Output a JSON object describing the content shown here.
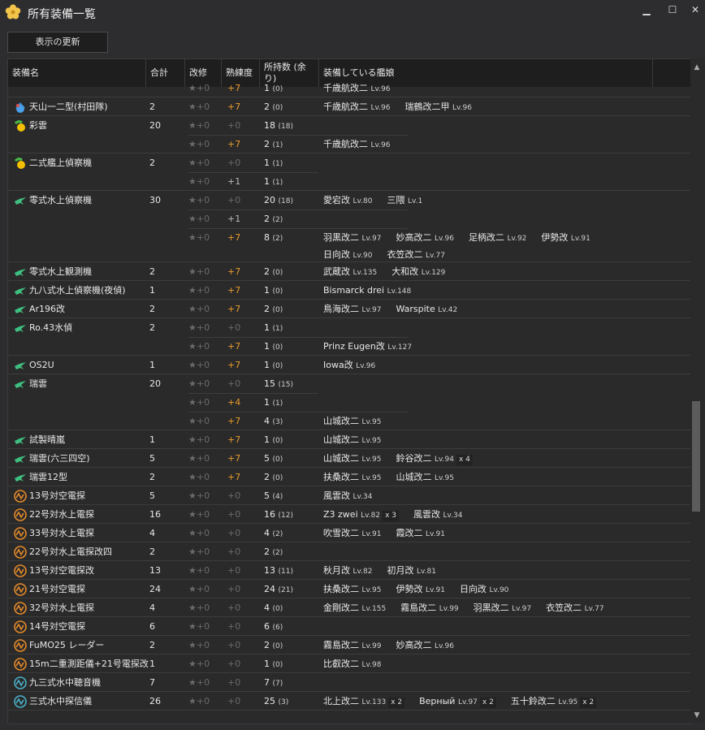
{
  "window": {
    "title": "所有装備一覧",
    "min": "▁",
    "max": "☐",
    "close": "✕"
  },
  "toolbar": {
    "refresh_label": "表示の更新"
  },
  "columns": [
    "装備名",
    "合計",
    "改修",
    "熟練度",
    "所持数 (余り)",
    "装備している艦娘"
  ],
  "rows": [
    {
      "name": "",
      "icon": "",
      "total": "",
      "subs": [
        {
          "imp": "★+0",
          "prof": "+7",
          "ptype": "pp",
          "count": "1",
          "rem": "(0)",
          "ships": [
            {
              "n": "千歳航改二",
              "lv": "Lv.96"
            }
          ]
        }
      ]
    },
    {
      "name": "天山一二型(村田隊)",
      "icon": "torpedo-bomber-icon",
      "total": "2",
      "subs": [
        {
          "imp": "★+0",
          "prof": "+7",
          "ptype": "pp",
          "count": "2",
          "rem": "(0)",
          "ships": [
            {
              "n": "千歳航改二",
              "lv": "Lv.96"
            },
            {
              "n": "瑞鶴改二甲",
              "lv": "Lv.96"
            }
          ]
        }
      ]
    },
    {
      "name": "彩雲",
      "icon": "recon-plane-icon",
      "total": "20",
      "subs": [
        {
          "imp": "★+0",
          "prof": "+0",
          "ptype": "p0",
          "count": "18",
          "rem": "(18)",
          "ships": []
        },
        {
          "imp": "★+0",
          "prof": "+7",
          "ptype": "pp",
          "count": "2",
          "rem": "(1)",
          "ships": [
            {
              "n": "千歳航改二",
              "lv": "Lv.96"
            }
          ]
        }
      ]
    },
    {
      "name": "二式艦上偵察機",
      "icon": "recon-plane-icon",
      "total": "2",
      "subs": [
        {
          "imp": "★+0",
          "prof": "+0",
          "ptype": "p0",
          "count": "1",
          "rem": "(1)",
          "ships": []
        },
        {
          "imp": "★+0",
          "prof": "+1",
          "ptype": "p1",
          "count": "1",
          "rem": "(1)",
          "ships": []
        }
      ]
    },
    {
      "name": "零式水上偵察機",
      "icon": "seaplane-icon",
      "total": "30",
      "subs": [
        {
          "imp": "★+0",
          "prof": "+0",
          "ptype": "p0",
          "count": "20",
          "rem": "(18)",
          "ships": [
            {
              "n": "愛宕改",
              "lv": "Lv.80"
            },
            {
              "n": "三隈",
              "lv": "Lv.1"
            }
          ]
        },
        {
          "imp": "★+0",
          "prof": "+1",
          "ptype": "p1",
          "count": "2",
          "rem": "(2)",
          "ships": []
        },
        {
          "imp": "★+0",
          "prof": "+7",
          "ptype": "pp",
          "count": "8",
          "rem": "(2)",
          "tall": true,
          "ships": [
            {
              "n": "羽黒改二",
              "lv": "Lv.97"
            },
            {
              "n": "妙高改二",
              "lv": "Lv.96"
            },
            {
              "n": "足柄改二",
              "lv": "Lv.92"
            },
            {
              "n": "伊勢改",
              "lv": "Lv.91"
            },
            {
              "n": "日向改",
              "lv": "Lv.90"
            },
            {
              "n": "衣笠改二",
              "lv": "Lv.77"
            }
          ]
        }
      ]
    },
    {
      "name": "零式水上観測機",
      "icon": "seaplane-icon",
      "total": "2",
      "subs": [
        {
          "imp": "★+0",
          "prof": "+7",
          "ptype": "pp",
          "count": "2",
          "rem": "(0)",
          "ships": [
            {
              "n": "武蔵改",
              "lv": "Lv.135"
            },
            {
              "n": "大和改",
              "lv": "Lv.129"
            }
          ]
        }
      ]
    },
    {
      "name": "九八式水上偵察機(夜偵)",
      "icon": "seaplane-icon",
      "total": "1",
      "subs": [
        {
          "imp": "★+0",
          "prof": "+7",
          "ptype": "pp",
          "count": "1",
          "rem": "(0)",
          "ships": [
            {
              "n": "Bismarck drei",
              "lv": "Lv.148"
            }
          ]
        }
      ]
    },
    {
      "name": "Ar196改",
      "icon": "seaplane-icon",
      "total": "2",
      "subs": [
        {
          "imp": "★+0",
          "prof": "+7",
          "ptype": "pp",
          "count": "2",
          "rem": "(0)",
          "ships": [
            {
              "n": "鳥海改二",
              "lv": "Lv.97"
            },
            {
              "n": "Warspite",
              "lv": "Lv.42"
            }
          ]
        }
      ]
    },
    {
      "name": "Ro.43水偵",
      "icon": "seaplane-icon",
      "total": "2",
      "subs": [
        {
          "imp": "★+0",
          "prof": "+0",
          "ptype": "p0",
          "count": "1",
          "rem": "(1)",
          "ships": []
        },
        {
          "imp": "★+0",
          "prof": "+7",
          "ptype": "pp",
          "count": "1",
          "rem": "(0)",
          "ships": [
            {
              "n": "Prinz Eugen改",
              "lv": "Lv.127"
            }
          ]
        }
      ]
    },
    {
      "name": "OS2U",
      "icon": "seaplane-icon",
      "total": "1",
      "subs": [
        {
          "imp": "★+0",
          "prof": "+7",
          "ptype": "pp",
          "count": "1",
          "rem": "(0)",
          "ships": [
            {
              "n": "Iowa改",
              "lv": "Lv.96"
            }
          ]
        }
      ]
    },
    {
      "name": "瑞雲",
      "icon": "seaplane-icon",
      "total": "20",
      "subs": [
        {
          "imp": "★+0",
          "prof": "+0",
          "ptype": "p0",
          "count": "15",
          "rem": "(15)",
          "ships": []
        },
        {
          "imp": "★+0",
          "prof": "+4",
          "ptype": "pp",
          "count": "1",
          "rem": "(1)",
          "ships": []
        },
        {
          "imp": "★+0",
          "prof": "+7",
          "ptype": "pp",
          "count": "4",
          "rem": "(3)",
          "ships": [
            {
              "n": "山城改二",
              "lv": "Lv.95"
            }
          ]
        }
      ]
    },
    {
      "name": "試製晴嵐",
      "icon": "seaplane-icon",
      "total": "1",
      "subs": [
        {
          "imp": "★+0",
          "prof": "+7",
          "ptype": "pp",
          "count": "1",
          "rem": "(0)",
          "ships": [
            {
              "n": "山城改二",
              "lv": "Lv.95"
            }
          ]
        }
      ]
    },
    {
      "name": "瑞雲(六三四空)",
      "icon": "seaplane-icon",
      "total": "5",
      "subs": [
        {
          "imp": "★+0",
          "prof": "+7",
          "ptype": "pp",
          "count": "5",
          "rem": "(0)",
          "ships": [
            {
              "n": "山城改二",
              "lv": "Lv.95"
            },
            {
              "n": "鈴谷改二",
              "lv": "Lv.94",
              "mult": "x 4"
            }
          ]
        }
      ]
    },
    {
      "name": "瑞雲12型",
      "icon": "seaplane-icon",
      "total": "2",
      "subs": [
        {
          "imp": "★+0",
          "prof": "+7",
          "ptype": "pp",
          "count": "2",
          "rem": "(0)",
          "ships": [
            {
              "n": "扶桑改二",
              "lv": "Lv.95"
            },
            {
              "n": "山城改二",
              "lv": "Lv.95"
            }
          ]
        }
      ]
    },
    {
      "name": "13号対空電探",
      "icon": "radar-icon",
      "total": "5",
      "subs": [
        {
          "imp": "★+0",
          "prof": "+0",
          "ptype": "p0",
          "count": "5",
          "rem": "(4)",
          "ships": [
            {
              "n": "風雲改",
              "lv": "Lv.34"
            }
          ]
        }
      ]
    },
    {
      "name": "22号対水上電探",
      "icon": "radar-icon",
      "total": "16",
      "subs": [
        {
          "imp": "★+0",
          "prof": "+0",
          "ptype": "p0",
          "count": "16",
          "rem": "(12)",
          "ships": [
            {
              "n": "Z3 zwei",
              "lv": "Lv.82",
              "mult": "x 3"
            },
            {
              "n": "風雲改",
              "lv": "Lv.34"
            }
          ]
        }
      ]
    },
    {
      "name": "33号対水上電探",
      "icon": "radar-icon",
      "total": "4",
      "subs": [
        {
          "imp": "★+0",
          "prof": "+0",
          "ptype": "p0",
          "count": "4",
          "rem": "(2)",
          "ships": [
            {
              "n": "吹雪改二",
              "lv": "Lv.91"
            },
            {
              "n": "霞改二",
              "lv": "Lv.91"
            }
          ]
        }
      ]
    },
    {
      "name": "22号対水上電探改四",
      "icon": "radar-icon",
      "total": "2",
      "subs": [
        {
          "imp": "★+0",
          "prof": "+0",
          "ptype": "p0",
          "count": "2",
          "rem": "(2)",
          "ships": []
        }
      ]
    },
    {
      "name": "13号対空電探改",
      "icon": "radar-icon",
      "total": "13",
      "subs": [
        {
          "imp": "★+0",
          "prof": "+0",
          "ptype": "p0",
          "count": "13",
          "rem": "(11)",
          "ships": [
            {
              "n": "秋月改",
              "lv": "Lv.82"
            },
            {
              "n": "初月改",
              "lv": "Lv.81"
            }
          ]
        }
      ]
    },
    {
      "name": "21号対空電探",
      "icon": "radar-icon",
      "total": "24",
      "subs": [
        {
          "imp": "★+0",
          "prof": "+0",
          "ptype": "p0",
          "count": "24",
          "rem": "(21)",
          "ships": [
            {
              "n": "扶桑改二",
              "lv": "Lv.95"
            },
            {
              "n": "伊勢改",
              "lv": "Lv.91"
            },
            {
              "n": "日向改",
              "lv": "Lv.90"
            }
          ]
        }
      ]
    },
    {
      "name": "32号対水上電探",
      "icon": "radar-icon",
      "total": "4",
      "subs": [
        {
          "imp": "★+0",
          "prof": "+0",
          "ptype": "p0",
          "count": "4",
          "rem": "(0)",
          "ships": [
            {
              "n": "金剛改二",
              "lv": "Lv.155"
            },
            {
              "n": "霧島改二",
              "lv": "Lv.99"
            },
            {
              "n": "羽黒改二",
              "lv": "Lv.97"
            },
            {
              "n": "衣笠改二",
              "lv": "Lv.77"
            }
          ]
        }
      ]
    },
    {
      "name": "14号対空電探",
      "icon": "radar-icon",
      "total": "6",
      "subs": [
        {
          "imp": "★+0",
          "prof": "+0",
          "ptype": "p0",
          "count": "6",
          "rem": "(6)",
          "ships": []
        }
      ]
    },
    {
      "name": "FuMO25 レーダー",
      "icon": "radar-icon",
      "total": "2",
      "subs": [
        {
          "imp": "★+0",
          "prof": "+0",
          "ptype": "p0",
          "count": "2",
          "rem": "(0)",
          "ships": [
            {
              "n": "霧島改二",
              "lv": "Lv.99"
            },
            {
              "n": "妙高改二",
              "lv": "Lv.96"
            }
          ]
        }
      ]
    },
    {
      "name": "15m二重測距儀+21号電探改",
      "icon": "radar-icon",
      "total": "1",
      "subs": [
        {
          "imp": "★+0",
          "prof": "+0",
          "ptype": "p0",
          "count": "1",
          "rem": "(0)",
          "ships": [
            {
              "n": "比叡改二",
              "lv": "Lv.98"
            }
          ]
        }
      ]
    },
    {
      "name": "九三式水中聴音機",
      "icon": "sonar-icon",
      "total": "7",
      "subs": [
        {
          "imp": "★+0",
          "prof": "+0",
          "ptype": "p0",
          "count": "7",
          "rem": "(7)",
          "ships": []
        }
      ]
    },
    {
      "name": "三式水中探信儀",
      "icon": "sonar-icon",
      "total": "26",
      "subs": [
        {
          "imp": "★+0",
          "prof": "+0",
          "ptype": "p0",
          "count": "25",
          "rem": "(3)",
          "ships": [
            {
              "n": "北上改二",
              "lv": "Lv.133",
              "mult": "x 2"
            },
            {
              "n": "Верный",
              "lv": "Lv.97",
              "mult": "x 2"
            },
            {
              "n": "五十鈴改二",
              "lv": "Lv.95",
              "mult": "x 2"
            }
          ]
        }
      ]
    }
  ]
}
